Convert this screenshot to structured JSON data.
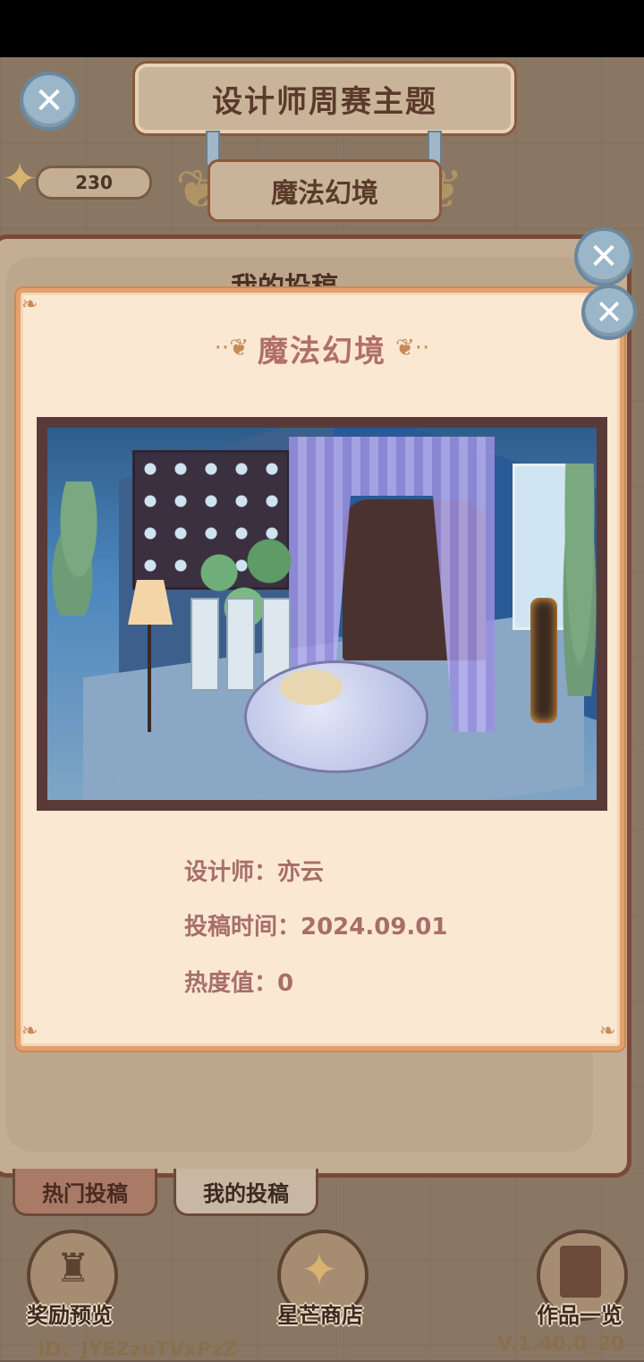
{
  "header": {
    "title": "设计师周赛主题",
    "theme": "魔法幻境",
    "star_count": "230"
  },
  "back_panel": {
    "title": "我的投稿"
  },
  "tabs": [
    {
      "label": "热门投稿"
    },
    {
      "label": "我的投稿"
    }
  ],
  "bottom_nav": [
    {
      "label": "奖励预览",
      "icon": "trophy-icon"
    },
    {
      "label": "星芒商店",
      "icon": "star-compass-icon"
    },
    {
      "label": "作品一览",
      "icon": "book-icon"
    }
  ],
  "footer": {
    "user_id": "ID：JYEZzuTVxPzZ",
    "version": "V.1.40.0_20"
  },
  "modal": {
    "title": "魔法幻境",
    "designer": "设计师：亦云",
    "submit_time": "投稿时间：2024.09.01",
    "heat": "热度值：0",
    "preview_image": "magic-bedroom-room-render"
  },
  "colors": {
    "modal_bg": "#fbe8d3",
    "modal_border": "#e6a06c",
    "accent_text": "#a66f68",
    "close_button": "#9bb6c8"
  }
}
